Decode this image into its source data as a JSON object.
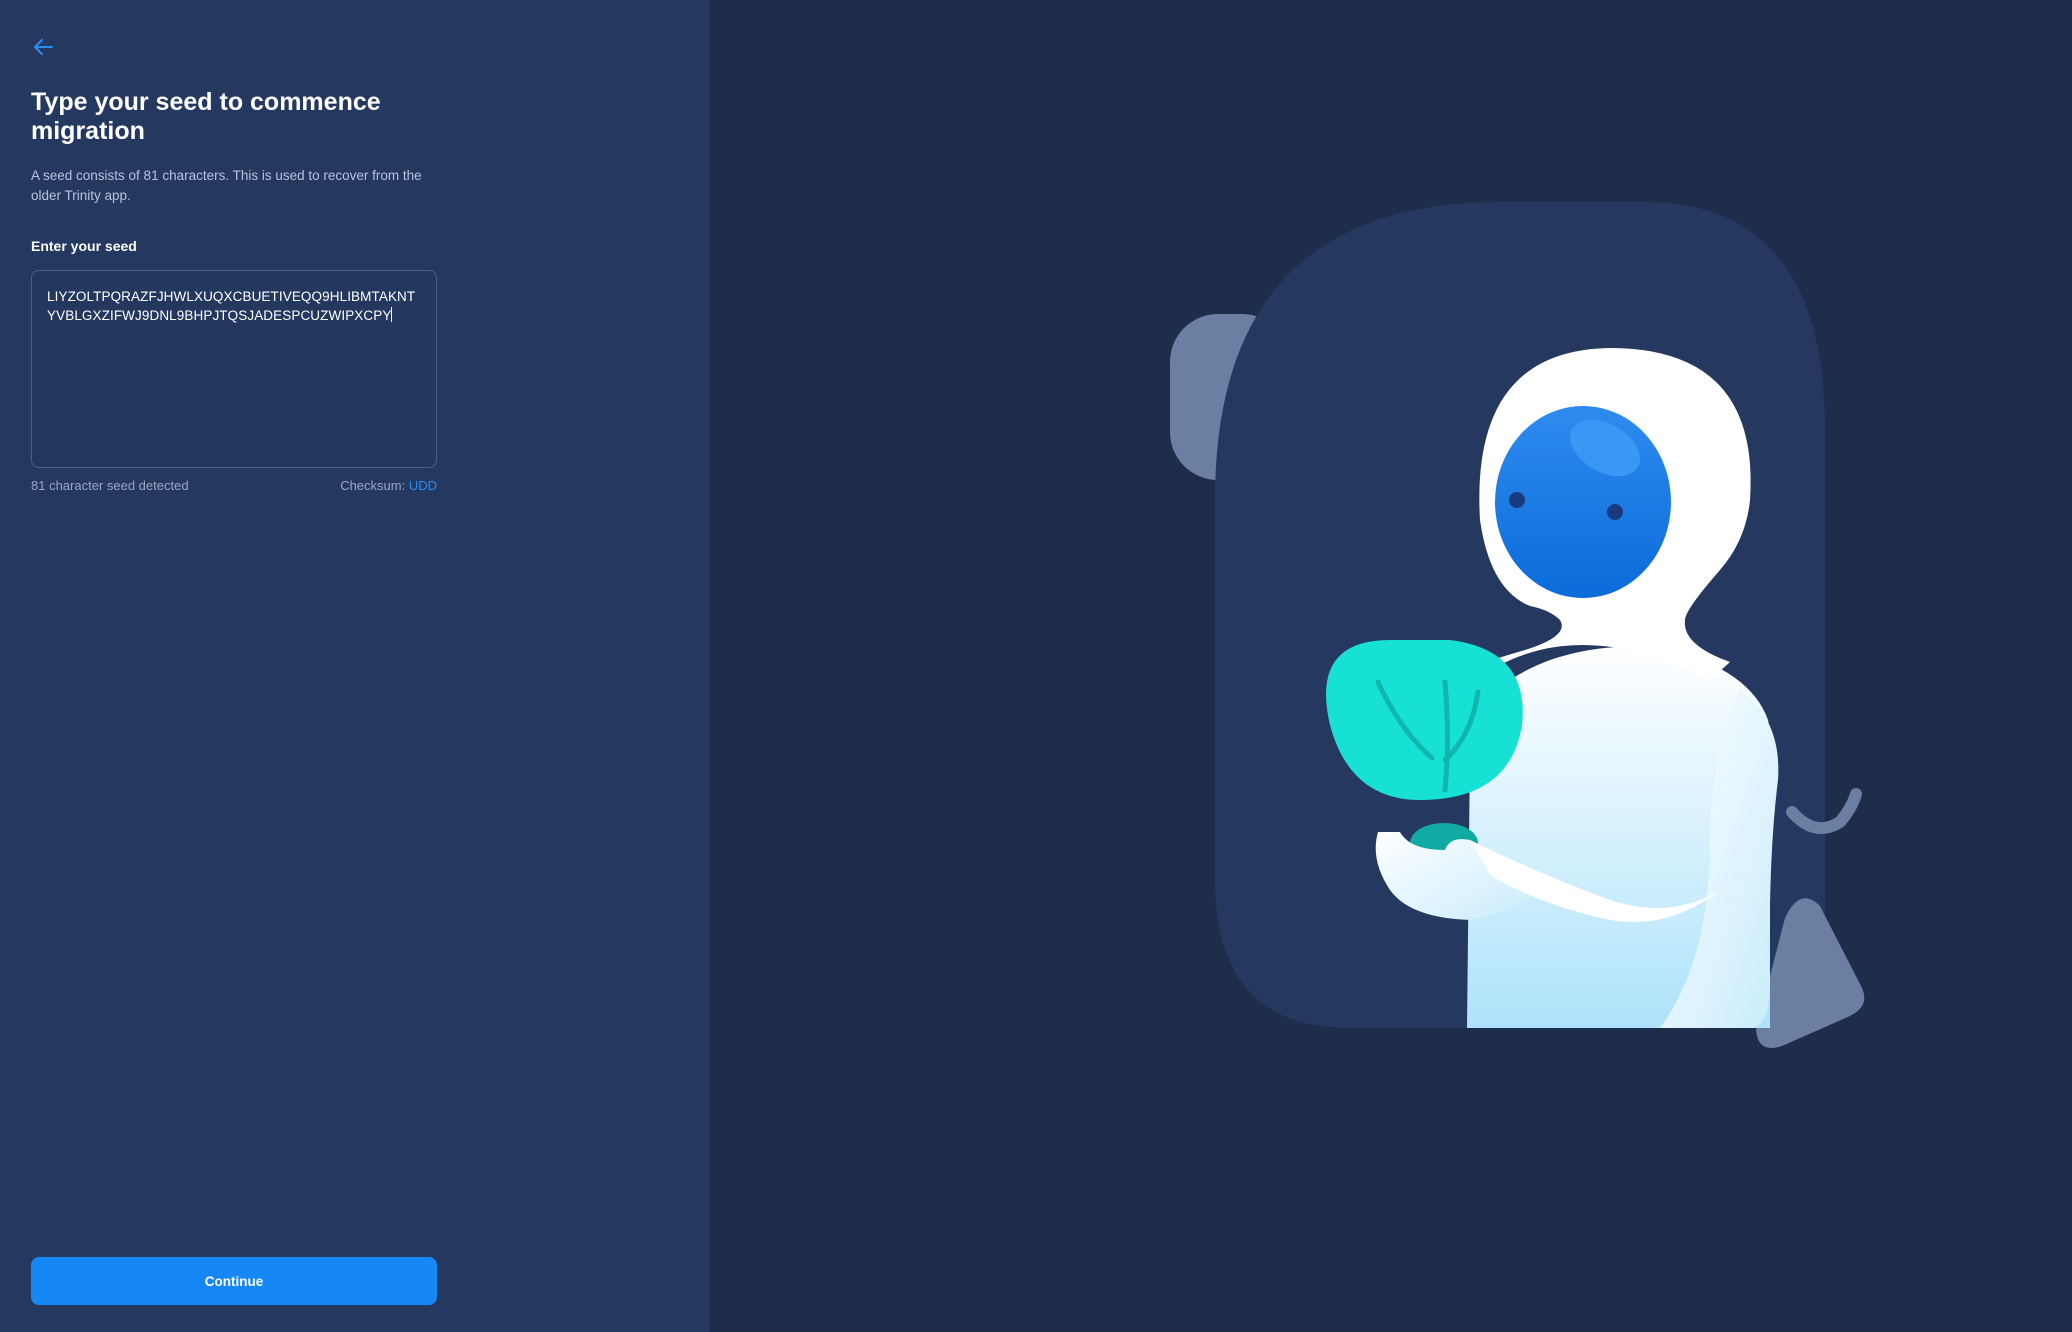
{
  "header": {
    "back_icon": "arrow-left-icon"
  },
  "main": {
    "title": "Type your seed to commence migration",
    "description": "A seed consists of 81 characters. This is used to recover from the older Trinity app.",
    "seed_label": "Enter your seed",
    "seed_value": "LIYZOLTPQRAZFJHWLXUQXCBUETIVEQQ9HLIBMTAKNTYVBLGXZIFWJ9DNL9BHPJTQSJADESPCUZWIPXCPY",
    "seed_status": "81 character seed detected",
    "checksum_label": "Checksum: ",
    "checksum_value": "UDD",
    "continue_label": "Continue"
  },
  "colors": {
    "sidebar_bg": "#243860",
    "page_bg": "#1e2d4a",
    "accent": "#1688f5",
    "checksum": "#2a8df5"
  }
}
